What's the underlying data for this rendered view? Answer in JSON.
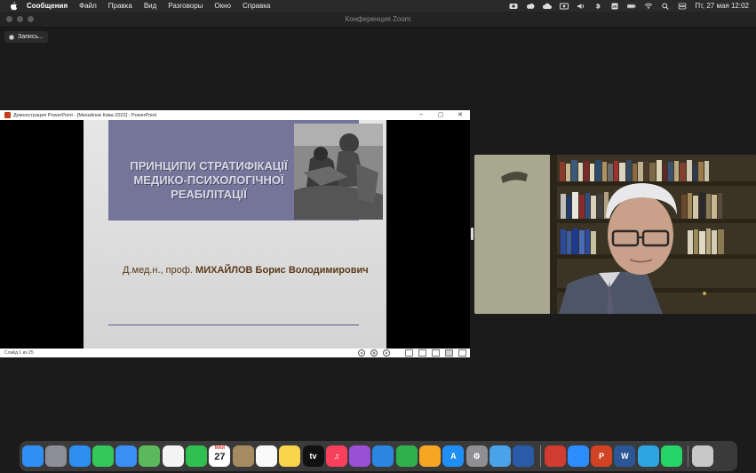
{
  "menubar": {
    "app_name": "Сообщения",
    "items": [
      "Файл",
      "Правка",
      "Вид",
      "Разговоры",
      "Окно",
      "Справка"
    ],
    "clock": "Пт, 27 мая  12:02"
  },
  "zoom": {
    "window_title": "Конференция Zoom",
    "recording_label": "Запись..."
  },
  "powerpoint": {
    "window_title": "Демонстрация PowerPoint - [Михайлов Кива 2022] - PowerPoint",
    "minimize": "−",
    "maximize": "▢",
    "close": "✕",
    "slide_counter": "Слайд 1 из 25",
    "slide": {
      "title_lines": [
        "ПРИНЦИПИ СТРАТИФІКАЦІЇ",
        "МЕДИКО-ПСИХОЛОГІЧНОЇ",
        "РЕАБІЛІТАЦІЇ"
      ],
      "author_prefix": "Д.мед.н., проф. ",
      "author_name": "МИХАЙЛОВ  Борис Володимирович"
    }
  },
  "dock": {
    "apps": [
      {
        "name": "finder-icon",
        "color": "#2f8ff5",
        "glyph": ""
      },
      {
        "name": "launchpad-icon",
        "color": "#8d8d98",
        "glyph": ""
      },
      {
        "name": "safari-icon",
        "color": "#2d8ef0",
        "glyph": ""
      },
      {
        "name": "messages-icon",
        "color": "#34c759",
        "glyph": ""
      },
      {
        "name": "mail-icon",
        "color": "#3a8ff5",
        "glyph": ""
      },
      {
        "name": "maps-icon",
        "color": "#5cb85c",
        "glyph": ""
      },
      {
        "name": "photos-icon",
        "color": "#f4f4f4",
        "glyph": ""
      },
      {
        "name": "facetime-icon",
        "color": "#30c04f",
        "glyph": ""
      },
      {
        "name": "calendar-icon",
        "color": "#ffffff",
        "glyph": "27",
        "label": "МАЙ"
      },
      {
        "name": "contacts-icon",
        "color": "#a58a62",
        "glyph": ""
      },
      {
        "name": "reminders-icon",
        "color": "#fafafa",
        "glyph": ""
      },
      {
        "name": "notes-icon",
        "color": "#f7d44a",
        "glyph": ""
      },
      {
        "name": "apple-tv-icon",
        "color": "#111111",
        "glyph": "tv"
      },
      {
        "name": "music-icon",
        "color": "#f83f5b",
        "glyph": "♫"
      },
      {
        "name": "podcasts-icon",
        "color": "#9b4fd6",
        "glyph": ""
      },
      {
        "name": "keynote-icon",
        "color": "#2a86e0",
        "glyph": ""
      },
      {
        "name": "numbers-icon",
        "color": "#2fb04c",
        "glyph": ""
      },
      {
        "name": "pages-icon",
        "color": "#f5a623",
        "glyph": ""
      },
      {
        "name": "app-store-icon",
        "color": "#1f8ef5",
        "glyph": "A"
      },
      {
        "name": "system-preferences-icon",
        "color": "#8e8e93",
        "glyph": "⚙"
      },
      {
        "name": "network-utility-icon",
        "color": "#4aa3e8",
        "glyph": ""
      },
      {
        "name": "remote-desktop-icon",
        "color": "#2a5ba8",
        "glyph": ""
      },
      {
        "divider": true
      },
      {
        "name": "cisco-webex-icon",
        "color": "#d23b2f",
        "glyph": ""
      },
      {
        "name": "zoom-icon",
        "color": "#2d8cff",
        "glyph": ""
      },
      {
        "name": "powerpoint-icon",
        "color": "#d04423",
        "glyph": "P"
      },
      {
        "name": "word-icon",
        "color": "#2b5797",
        "glyph": "W"
      },
      {
        "name": "telegram-icon",
        "color": "#2ca5e0",
        "glyph": ""
      },
      {
        "name": "whatsapp-icon",
        "color": "#25d366",
        "glyph": ""
      },
      {
        "divider": true
      },
      {
        "name": "trash-icon",
        "color": "#c8c8c8",
        "glyph": ""
      }
    ]
  }
}
